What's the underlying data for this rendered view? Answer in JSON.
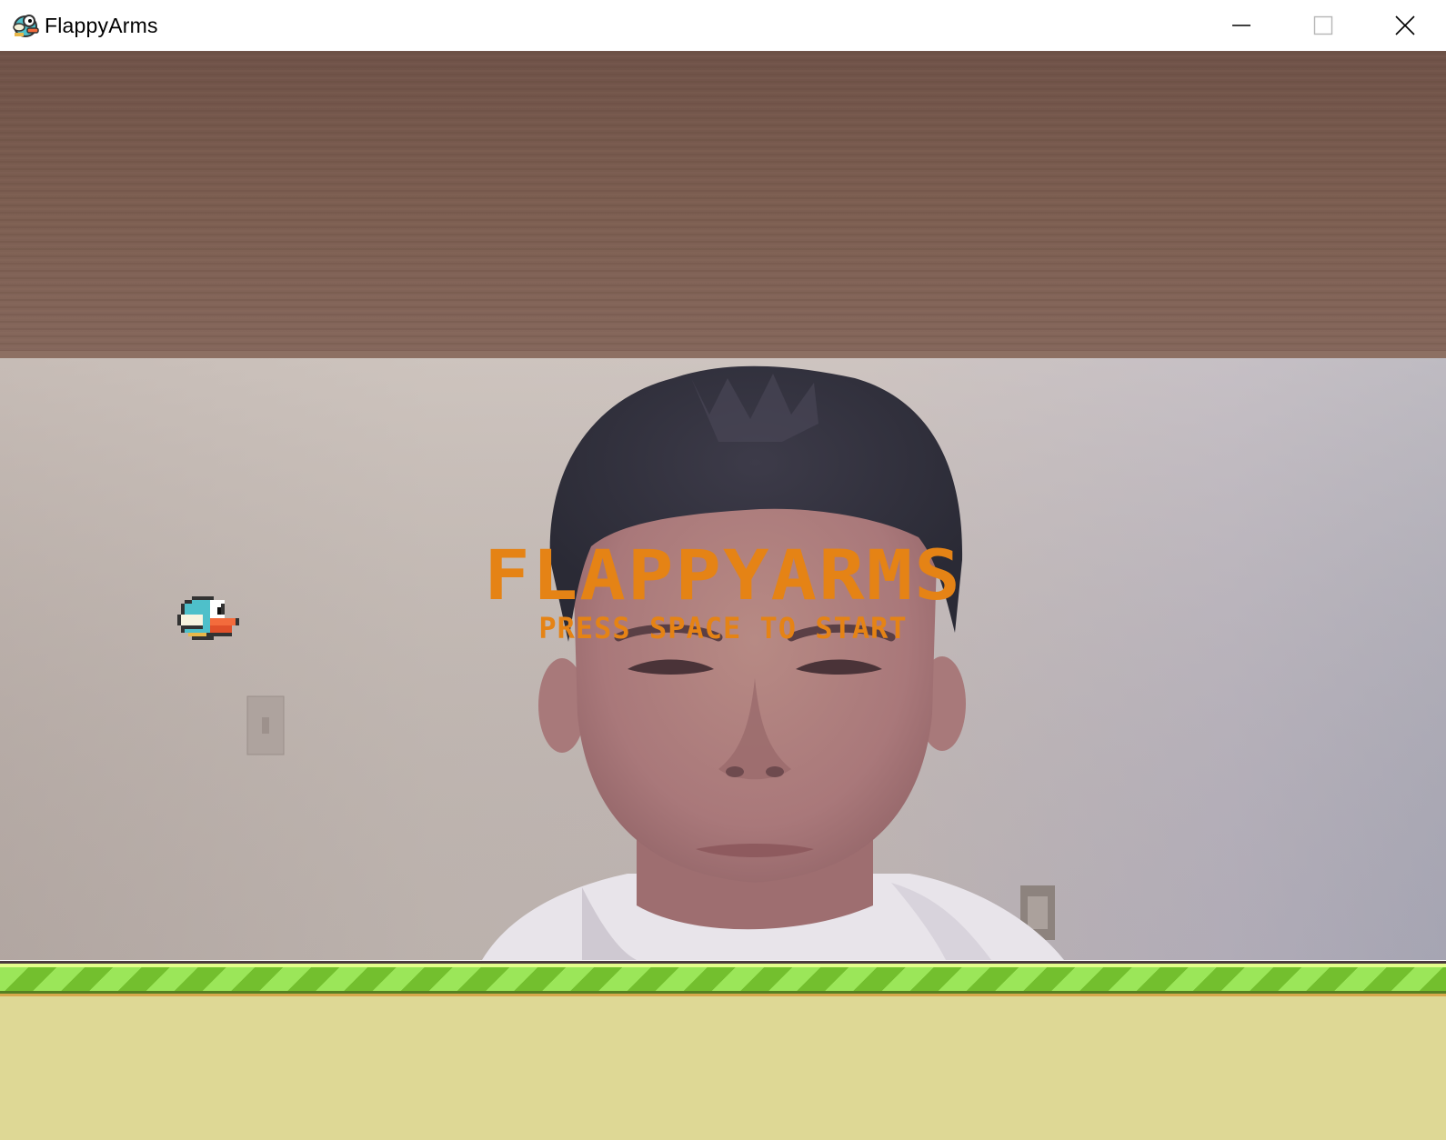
{
  "window": {
    "title": "FlappyArms",
    "icon": "flappy-bird-icon",
    "controls": {
      "minimize_icon": "minimize-icon",
      "maximize_icon": "maximize-icon",
      "close_icon": "close-icon"
    }
  },
  "game": {
    "title": "FLAPPYARMS",
    "subtitle": "PRESS SPACE TO START",
    "background": "webcam-feed",
    "bird": "blue-flappy-bird",
    "colors": {
      "title_text": "#e58315",
      "grass_light": "#9be659",
      "grass_dark": "#73bf2e",
      "dirt": "#ded895",
      "bird_body": "#4ec0ca"
    }
  }
}
